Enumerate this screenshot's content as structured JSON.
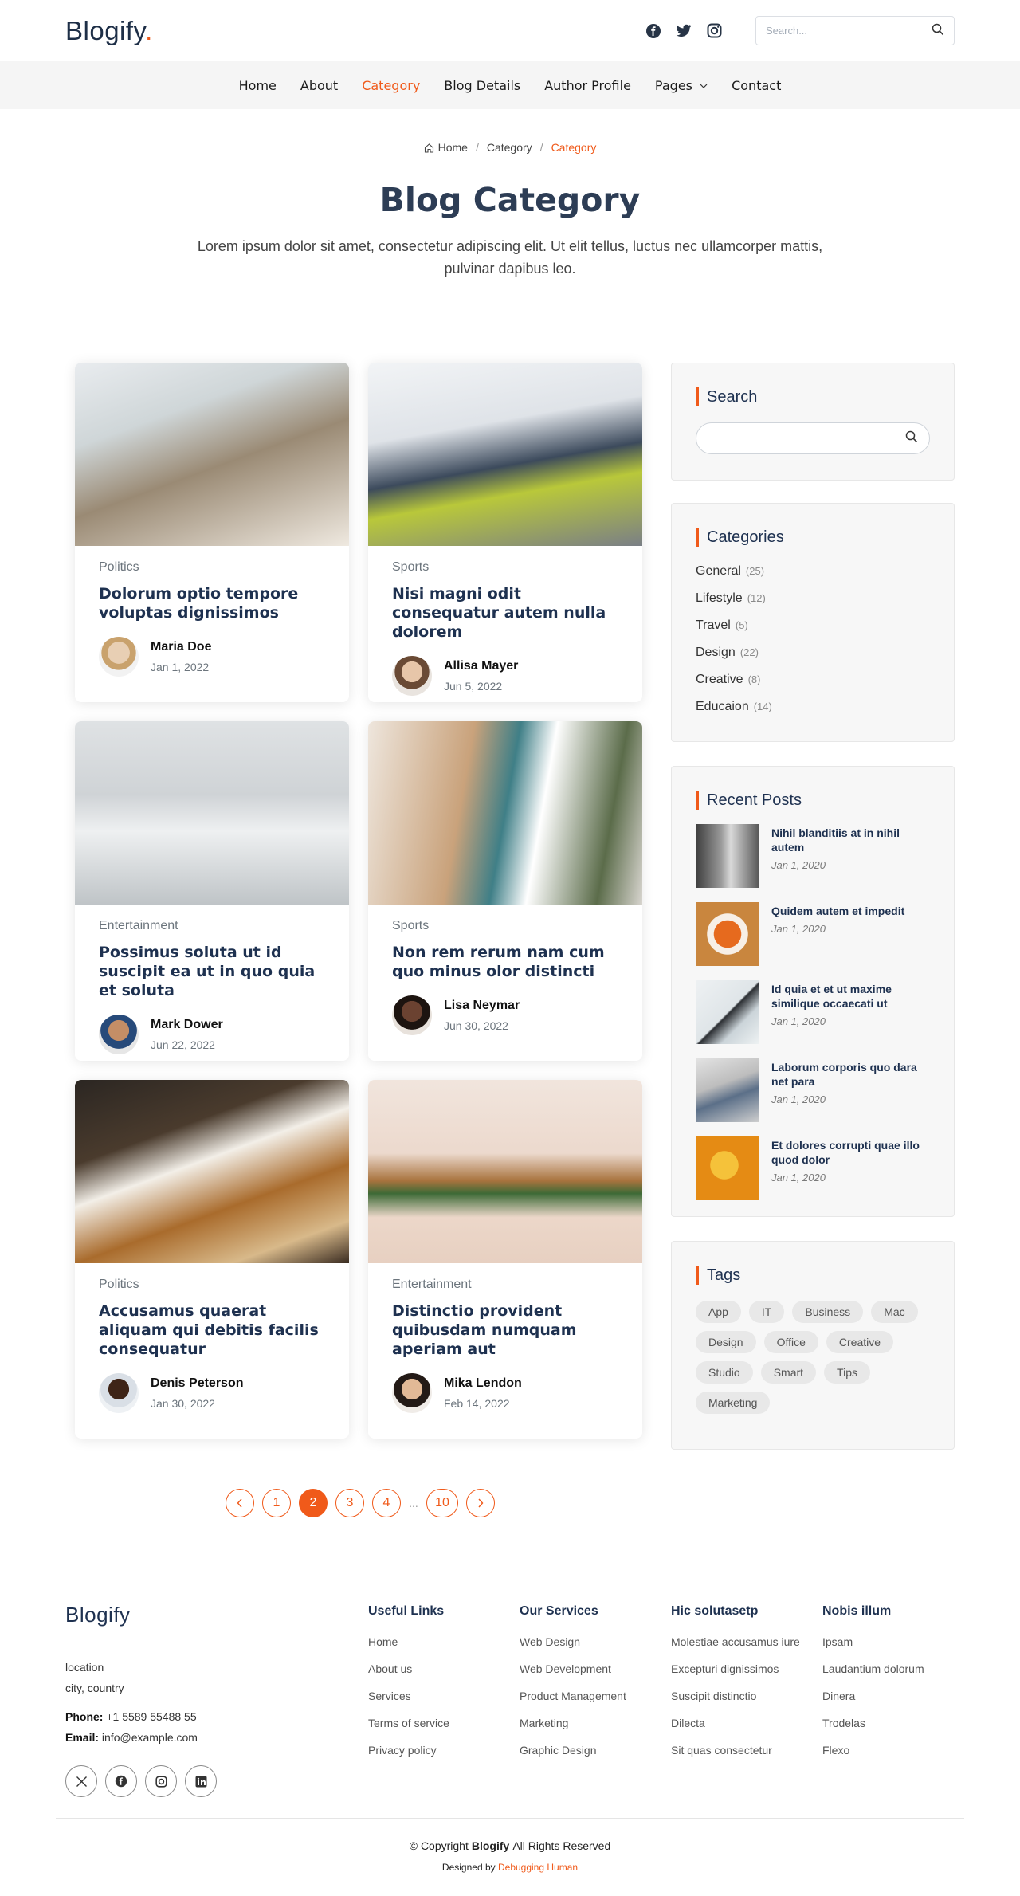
{
  "header": {
    "logo_text": "Blogify",
    "logo_dot": ".",
    "search_placeholder": "Search...",
    "social_icons": [
      "facebook-icon",
      "twitter-icon",
      "instagram-icon"
    ]
  },
  "nav": {
    "items": [
      "Home",
      "About",
      "Category",
      "Blog Details",
      "Author Profile",
      "Pages",
      "Contact"
    ],
    "active": "Category"
  },
  "breadcrumb": {
    "home": "Home",
    "sep": "/",
    "middle": "Category",
    "current": "Category"
  },
  "page": {
    "title": "Blog Category",
    "description": "Lorem ipsum dolor sit amet, consectetur adipiscing elit. Ut elit tellus, luctus nec ullamcorper mattis, pulvinar dapibus leo."
  },
  "posts": [
    {
      "category": "Politics",
      "title": "Dolorum optio tempore voluptas dignissimos",
      "author": "Maria Doe",
      "date": "Jan 1, 2022"
    },
    {
      "category": "Sports",
      "title": "Nisi magni odit consequatur autem nulla dolorem",
      "author": "Allisa Mayer",
      "date": "Jun 5, 2022"
    },
    {
      "category": "Entertainment",
      "title": "Possimus soluta ut id suscipit ea ut in quo quia et soluta",
      "author": "Mark Dower",
      "date": "Jun 22, 2022"
    },
    {
      "category": "Sports",
      "title": "Non rem rerum nam cum quo minus olor distincti",
      "author": "Lisa Neymar",
      "date": "Jun 30, 2022"
    },
    {
      "category": "Politics",
      "title": "Accusamus quaerat aliquam qui debitis facilis consequatur",
      "author": "Denis Peterson",
      "date": "Jan 30, 2022"
    },
    {
      "category": "Entertainment",
      "title": "Distinctio provident quibusdam numquam aperiam aut",
      "author": "Mika Lendon",
      "date": "Feb 14, 2022"
    }
  ],
  "sidebar": {
    "search_title": "Search",
    "categories_title": "Categories",
    "categories": [
      {
        "name": "General",
        "count": "(25)"
      },
      {
        "name": "Lifestyle",
        "count": "(12)"
      },
      {
        "name": "Travel",
        "count": "(5)"
      },
      {
        "name": "Design",
        "count": "(22)"
      },
      {
        "name": "Creative",
        "count": "(8)"
      },
      {
        "name": "Educaion",
        "count": "(14)"
      }
    ],
    "recent_title": "Recent Posts",
    "recent": [
      {
        "title": "Nihil blanditiis at in nihil autem",
        "date": "Jan 1, 2020"
      },
      {
        "title": "Quidem autem et impedit",
        "date": "Jan 1, 2020"
      },
      {
        "title": "Id quia et et ut maxime similique occaecati ut",
        "date": "Jan 1, 2020"
      },
      {
        "title": "Laborum corporis quo dara net para",
        "date": "Jan 1, 2020"
      },
      {
        "title": "Et dolores corrupti quae illo quod dolor",
        "date": "Jan 1, 2020"
      }
    ],
    "tags_title": "Tags",
    "tags": [
      "App",
      "IT",
      "Business",
      "Mac",
      "Design",
      "Office",
      "Creative",
      "Studio",
      "Smart",
      "Tips",
      "Marketing"
    ]
  },
  "pagination": {
    "pages": [
      "1",
      "2",
      "3",
      "4"
    ],
    "current": "2",
    "ellipsis": "...",
    "last": "10"
  },
  "footer": {
    "logo": "Blogify",
    "address_line1": "location",
    "address_line2": "city, country",
    "phone_label": "Phone:",
    "phone": "+1 5589 55488 55",
    "email_label": "Email:",
    "email": "info@example.com",
    "social_icons": [
      "x-icon",
      "facebook-icon",
      "instagram-icon",
      "linkedin-icon"
    ],
    "columns": [
      {
        "title": "Useful Links",
        "links": [
          "Home",
          "About us",
          "Services",
          "Terms of service",
          "Privacy policy"
        ]
      },
      {
        "title": "Our Services",
        "links": [
          "Web Design",
          "Web Development",
          "Product Management",
          "Marketing",
          "Graphic Design"
        ]
      },
      {
        "title": "Hic solutasetp",
        "links": [
          "Molestiae accusamus iure",
          "Excepturi dignissimos",
          "Suscipit distinctio",
          "Dilecta",
          "Sit quas consectetur"
        ]
      },
      {
        "title": "Nobis illum",
        "links": [
          "Ipsam",
          "Laudantium dolorum",
          "Dinera",
          "Trodelas",
          "Flexo"
        ]
      }
    ],
    "copyright_prefix": "© Copyright",
    "copyright_brand": "Blogify",
    "copyright_suffix": "All Rights Reserved",
    "designed_by": "Designed by",
    "designer": "Debugging Human"
  },
  "colors": {
    "accent": "#f05a1a",
    "heading": "#1e3150",
    "nav_bg": "#f5f5f5"
  }
}
